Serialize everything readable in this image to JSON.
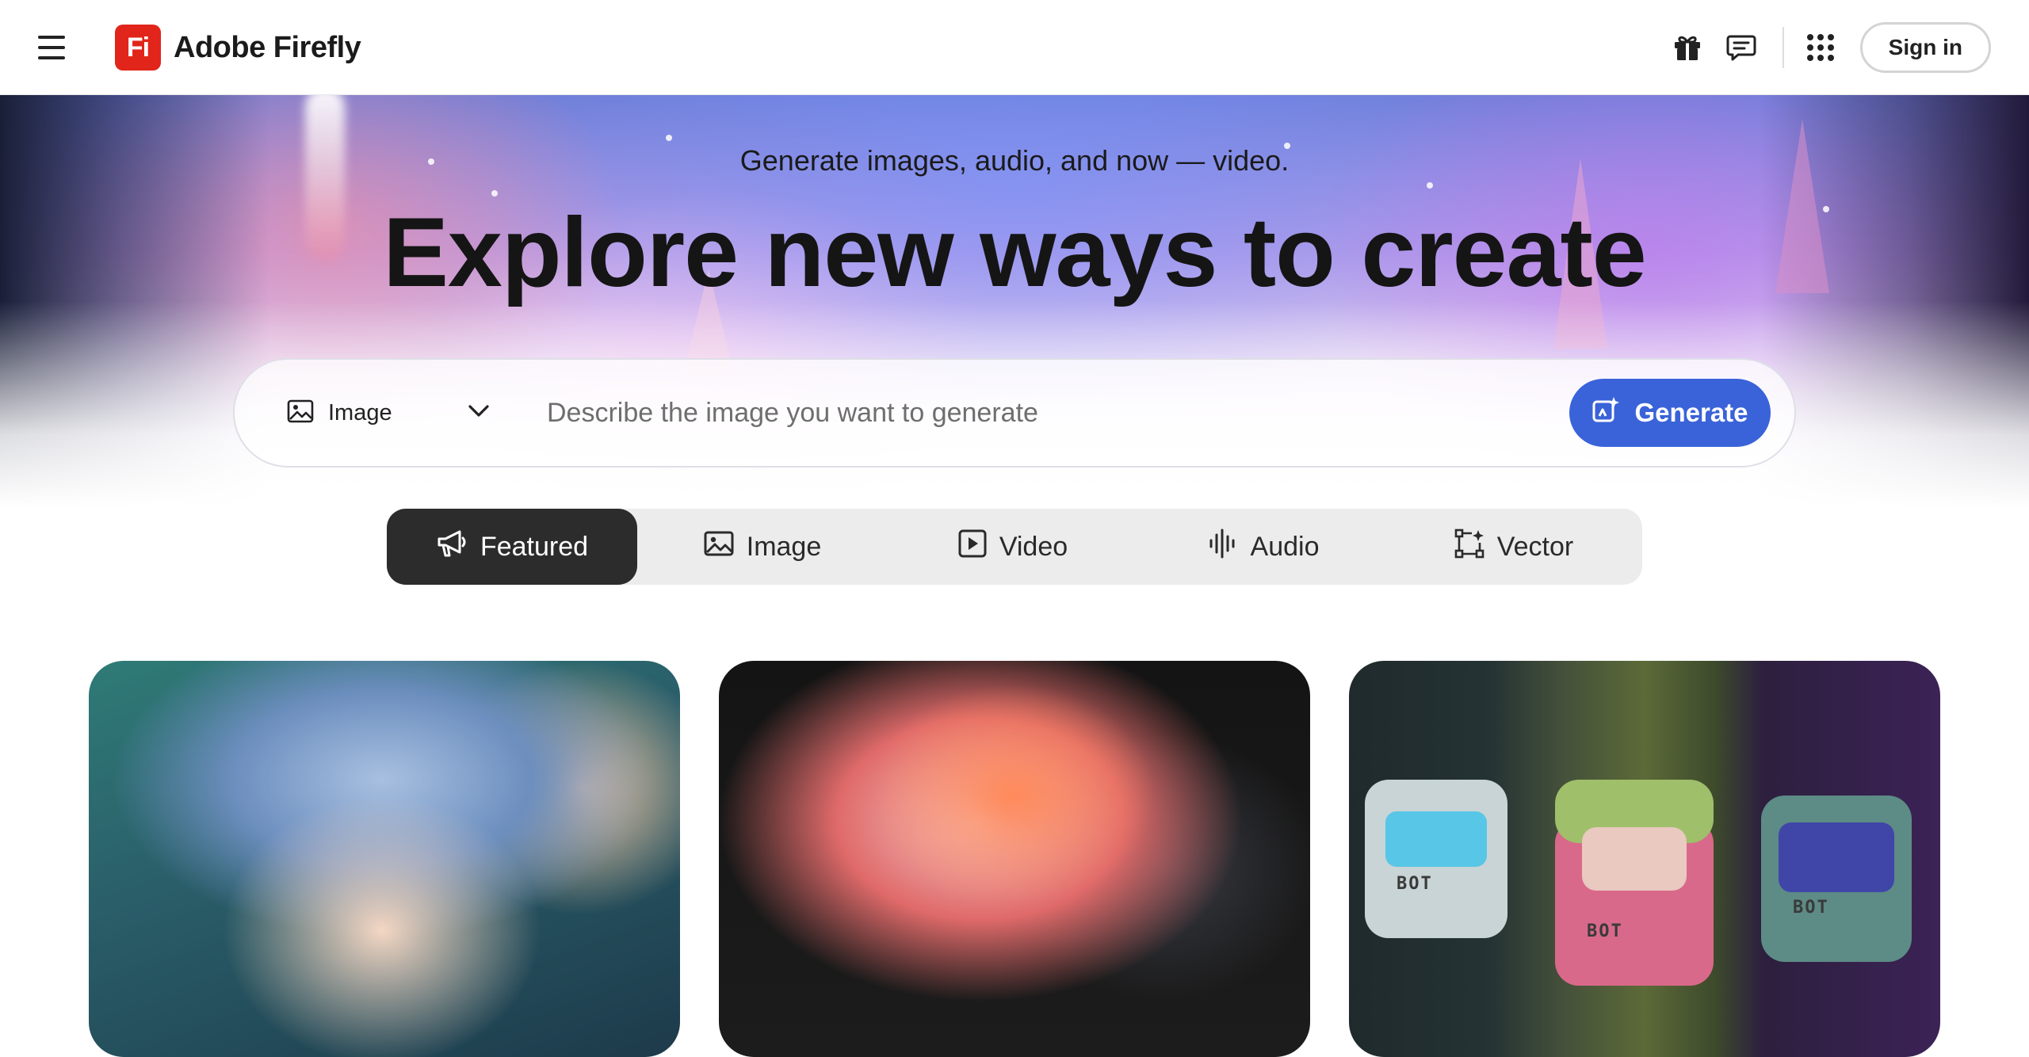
{
  "app": {
    "brand_mark": "Fi",
    "brand_name": "Adobe Firefly"
  },
  "header": {
    "icons": [
      "menu-icon",
      "gift-icon",
      "feedback-icon",
      "apps-grid-icon"
    ],
    "sign_in_label": "Sign in"
  },
  "hero": {
    "subtitle": "Generate images, audio, and now — video.",
    "title": "Explore new ways to create"
  },
  "prompt": {
    "type_label": "Image",
    "placeholder": "Describe the image you want to generate",
    "value": "",
    "generate_label": "Generate"
  },
  "tabs": [
    {
      "label": "Featured",
      "icon": "megaphone-icon",
      "active": true
    },
    {
      "label": "Image",
      "icon": "image-icon",
      "active": false
    },
    {
      "label": "Video",
      "icon": "video-icon",
      "active": false
    },
    {
      "label": "Audio",
      "icon": "audio-icon",
      "active": false
    },
    {
      "label": "Vector",
      "icon": "vector-icon",
      "active": false
    }
  ],
  "cards": [
    {
      "subject": "boy-with-blue-hair-illustration"
    },
    {
      "subject": "parrot-closeup-illustration"
    },
    {
      "subject": "knitted-robots-illustration",
      "tags": [
        "BOT",
        "BOT",
        "BOT"
      ]
    }
  ],
  "colors": {
    "brand_red": "#e1251b",
    "accent_blue": "#3a63d9",
    "active_tab_bg": "#2c2c2c",
    "tabs_bg": "#ececec"
  }
}
